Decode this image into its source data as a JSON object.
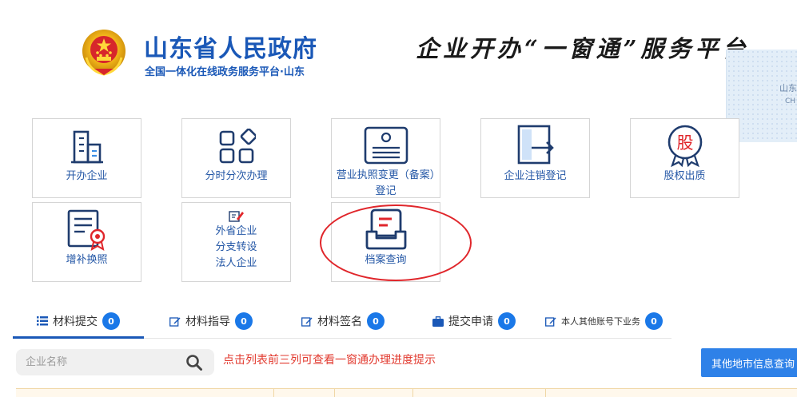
{
  "header": {
    "gov_title": "山东省人民政府",
    "gov_subtitle": "全国一体化在线政务服务平台·山东",
    "platform_title": "企业开办“一窗通”服务平台",
    "side_widget_line1": "山东",
    "side_widget_line2": "CH"
  },
  "tiles": [
    {
      "label": "开办企业",
      "icon": "building-icon"
    },
    {
      "label": "分时分次办理",
      "icon": "grid-shapes-icon"
    },
    {
      "label": "营业执照变更（备案）登记",
      "icon": "license-card-icon"
    },
    {
      "label": "企业注销登记",
      "icon": "exit-door-icon"
    },
    {
      "label": "股权出质",
      "icon": "equity-seal-icon"
    },
    {
      "label": "增补换照",
      "icon": "certificate-icon"
    },
    {
      "label_lines": [
        "外省企业",
        "分支转设",
        "法人企业"
      ],
      "icon": "edit-note-icon"
    },
    {
      "label": "档案查询",
      "icon": "archive-box-icon"
    }
  ],
  "tabs": [
    {
      "label": "材料提交",
      "count": "0",
      "icon": "list-icon",
      "active": true
    },
    {
      "label": "材料指导",
      "count": "0",
      "icon": "edit-icon",
      "active": false
    },
    {
      "label": "材料签名",
      "count": "0",
      "icon": "edit-icon",
      "active": false
    },
    {
      "label": "提交申请",
      "count": "0",
      "icon": "briefcase-icon",
      "active": false
    },
    {
      "label": "本人其他账号下业务",
      "count": "0",
      "icon": "edit-icon",
      "active": false
    }
  ],
  "search": {
    "placeholder": "企业名称",
    "value": ""
  },
  "hint_text": "点击列表前三列可查看一窗通办理进度提示",
  "other_button_label": "其他地市信息查询",
  "colors": {
    "brand_blue": "#1a58b7",
    "accent_blue": "#1a78e8",
    "button_blue": "#2e81e8",
    "hint_red": "#e23a2f",
    "highlight_ring": "#e0262b"
  }
}
